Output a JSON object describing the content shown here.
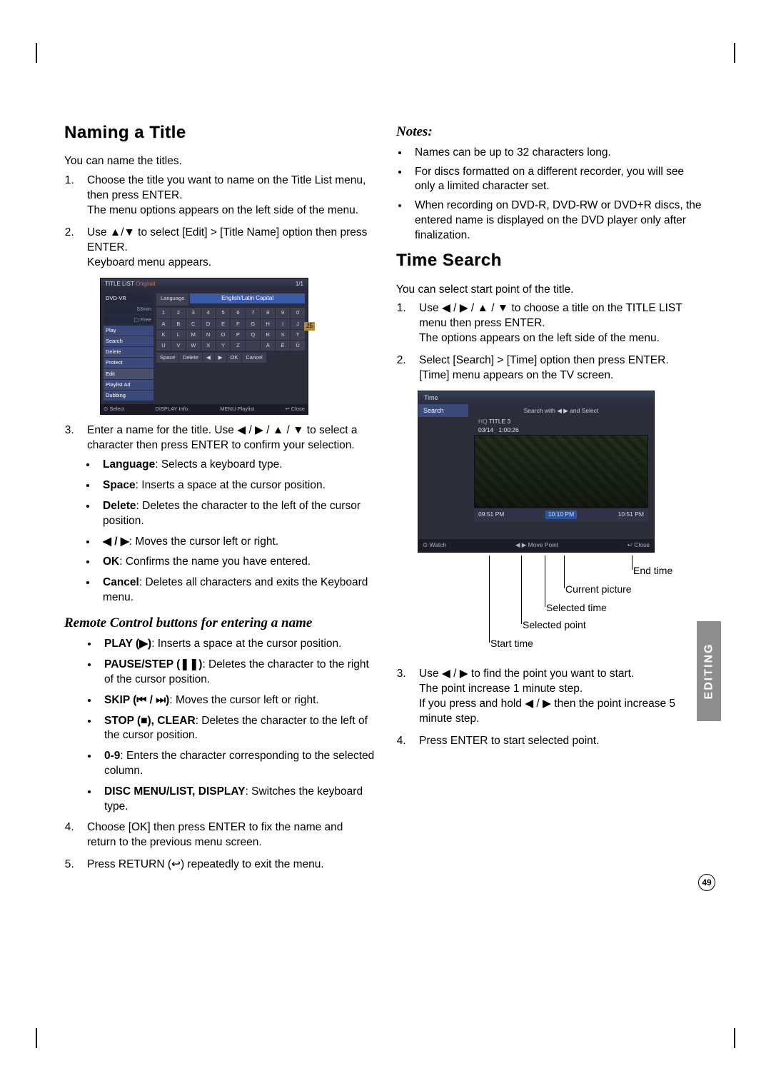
{
  "page_number": "49",
  "side_tab": "EDITING",
  "left": {
    "h1": "Naming a Title",
    "intro": "You can name the titles.",
    "s1": {
      "a": "Choose the title you want to name on the Title List menu, then press ENTER.",
      "b": "The menu options appears on the left side of the menu."
    },
    "s2": {
      "a": "Use ▲/▼ to select [Edit] > [Title Name] option then press ENTER.",
      "b": "Keyboard menu appears."
    },
    "osd_kb": {
      "titlebar_left": "TITLE LIST",
      "titlebar_mid": "Original",
      "titlebar_right": "1/1",
      "side_top_a": "DVD-VR",
      "side_top_b": "53min",
      "side_top_c": "▢ Free",
      "side_items": [
        "Play",
        "Search",
        "Delete",
        "Protect",
        "Edit",
        "Playlist Ad",
        "Dubbing"
      ],
      "main_lang_row": "Language        English/Latin Capital",
      "row1": [
        "1",
        "2",
        "3",
        "4",
        "5",
        "6",
        "7",
        "8",
        "9",
        "0"
      ],
      "row2": [
        "A",
        "B",
        "C",
        "D",
        "E",
        "F",
        "G",
        "H",
        "I",
        "J"
      ],
      "row3": [
        "K",
        "L",
        "M",
        "N",
        "O",
        "P",
        "Q",
        "R",
        "S",
        "T"
      ],
      "row4": [
        "U",
        "V",
        "W",
        "X",
        "Y",
        "Z",
        " ",
        "Ä",
        "É",
        "Ü"
      ],
      "btn_row": [
        "Space",
        "Delete",
        "◀",
        "▶",
        "OK",
        "Cancel"
      ],
      "foot_left": "⊙ Select",
      "foot_mid1": "DISPLAY Info.",
      "foot_mid2": "MENU Playlist",
      "foot_right": "↩ Close",
      "right_badge": "25"
    },
    "s3": {
      "a": "Enter a name for the title. Use ◀ / ▶ / ▲ / ▼ to select a character then press ENTER to confirm your selection."
    },
    "sub_bullets": [
      {
        "b": "Language",
        "t": ": Selects a keyboard type."
      },
      {
        "b": "Space",
        "t": ": Inserts a space at the cursor position."
      },
      {
        "b": "Delete",
        "t": ": Deletes the character to the left of the cursor position."
      },
      {
        "b": "◀ / ▶",
        "t": ": Moves the cursor left or right."
      },
      {
        "b": "OK",
        "t": ": Confirms the name you have entered."
      },
      {
        "b": "Cancel",
        "t": ": Deletes all characters and exits the Keyboard menu."
      }
    ],
    "remote_h": "Remote Control buttons for entering a name",
    "remote": [
      {
        "b": "PLAY (▶)",
        "t": ": Inserts a space at the cursor position."
      },
      {
        "b": "PAUSE/STEP (❚❚)",
        "t": ": Deletes the character to the right of the cursor position."
      },
      {
        "b": "SKIP (⏮ / ⏭)",
        "t": ": Moves the cursor left or right."
      },
      {
        "b": "STOP (■), CLEAR",
        "t": ": Deletes the character to the left of the cursor position."
      },
      {
        "b": "0-9",
        "t": ": Enters the character corresponding to the selected column."
      },
      {
        "b": "DISC MENU/LIST, DISPLAY",
        "t": ": Switches the keyboard type."
      }
    ],
    "s4": "Choose [OK] then press ENTER to fix the name and return to the previous menu screen.",
    "s5": "Press RETURN (↩) repeatedly to exit the menu."
  },
  "right": {
    "notes_h": "Notes:",
    "notes": [
      "Names can be up to 32 characters long.",
      "For discs formatted on a different recorder, you will see only a limited character set.",
      "When recording on DVD-R, DVD-RW or DVD+R discs, the entered name is displayed on the DVD player only after finalization."
    ],
    "h2": "Time Search",
    "intro2": "You can select start point of the title.",
    "t1": {
      "a": "Use ◀ / ▶ / ▲ / ▼ to choose a title on the TITLE LIST menu then press ENTER.",
      "b": "The options appears on the left side of the menu."
    },
    "t2": {
      "a": "Select [Search] > [Time] option then press ENTER.",
      "b": "[Time] menu appears on the TV screen."
    },
    "osd_ts": {
      "hbar": "Time",
      "side_items": [
        "Search"
      ],
      "srch": "Search with ◀ ▶ and Select",
      "title_no": "TITLE 3",
      "date": "03/14",
      "dur": "1:00:26",
      "b_left": "09:51 PM",
      "b_mid": "10:10 PM",
      "b_right": "10:51 PM",
      "f_left": "⊙ Watch",
      "f_mid": "◀ ▶ Move Point",
      "f_right": "↩ Close"
    },
    "callouts": {
      "end_time": "End time",
      "current_pic": "Current picture",
      "selected_time": "Selected time",
      "selected_point": "Selected point",
      "start_time": "Start time"
    },
    "t3": {
      "a": "Use ◀ / ▶ to find the point you want to start.",
      "b": "The point increase 1 minute step.",
      "c": "If you press and hold ◀ / ▶ then the point increase 5 minute step."
    },
    "t4": "Press ENTER to start selected point."
  }
}
